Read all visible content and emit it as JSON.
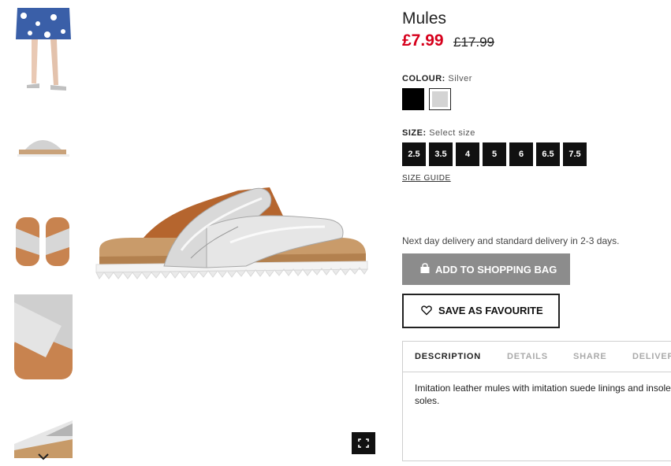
{
  "gallery": {
    "thumbnails": [
      {
        "alt": "model-wearing-mules"
      },
      {
        "alt": "mule-side-view"
      },
      {
        "alt": "mules-top-view"
      },
      {
        "alt": "mule-strap-closeup"
      },
      {
        "alt": "mule-sole-closeup"
      }
    ],
    "scroll_down_icon": "chevron-down-icon",
    "fullscreen_icon": "expand-icon"
  },
  "product": {
    "title": "Mules",
    "price": "£7.99",
    "old_price": "£17.99",
    "colour_label": "COLOUR:",
    "colour_value": "Silver",
    "colours": [
      "#000000",
      "#d4d4d4"
    ],
    "size_label": "SIZE:",
    "size_value": "Select size",
    "sizes": [
      "2.5",
      "3.5",
      "4",
      "5",
      "6",
      "6.5",
      "7.5"
    ],
    "size_guide": "SIZE GUIDE",
    "delivery": "Next day delivery and standard delivery in 2-3 days.",
    "add_to_bag": "ADD TO SHOPPING BAG",
    "save_favourite": "SAVE AS FAVOURITE"
  },
  "tabs": {
    "items": [
      "DESCRIPTION",
      "DETAILS",
      "SHARE",
      "DELIVERY"
    ],
    "active": "DESCRIPTION",
    "description": "Imitation leather mules with imitation suede linings and insoles. soles."
  },
  "colors": {
    "sale_red": "#d6001c",
    "button_grey": "#8c8c8c",
    "size_bg": "#111111"
  }
}
